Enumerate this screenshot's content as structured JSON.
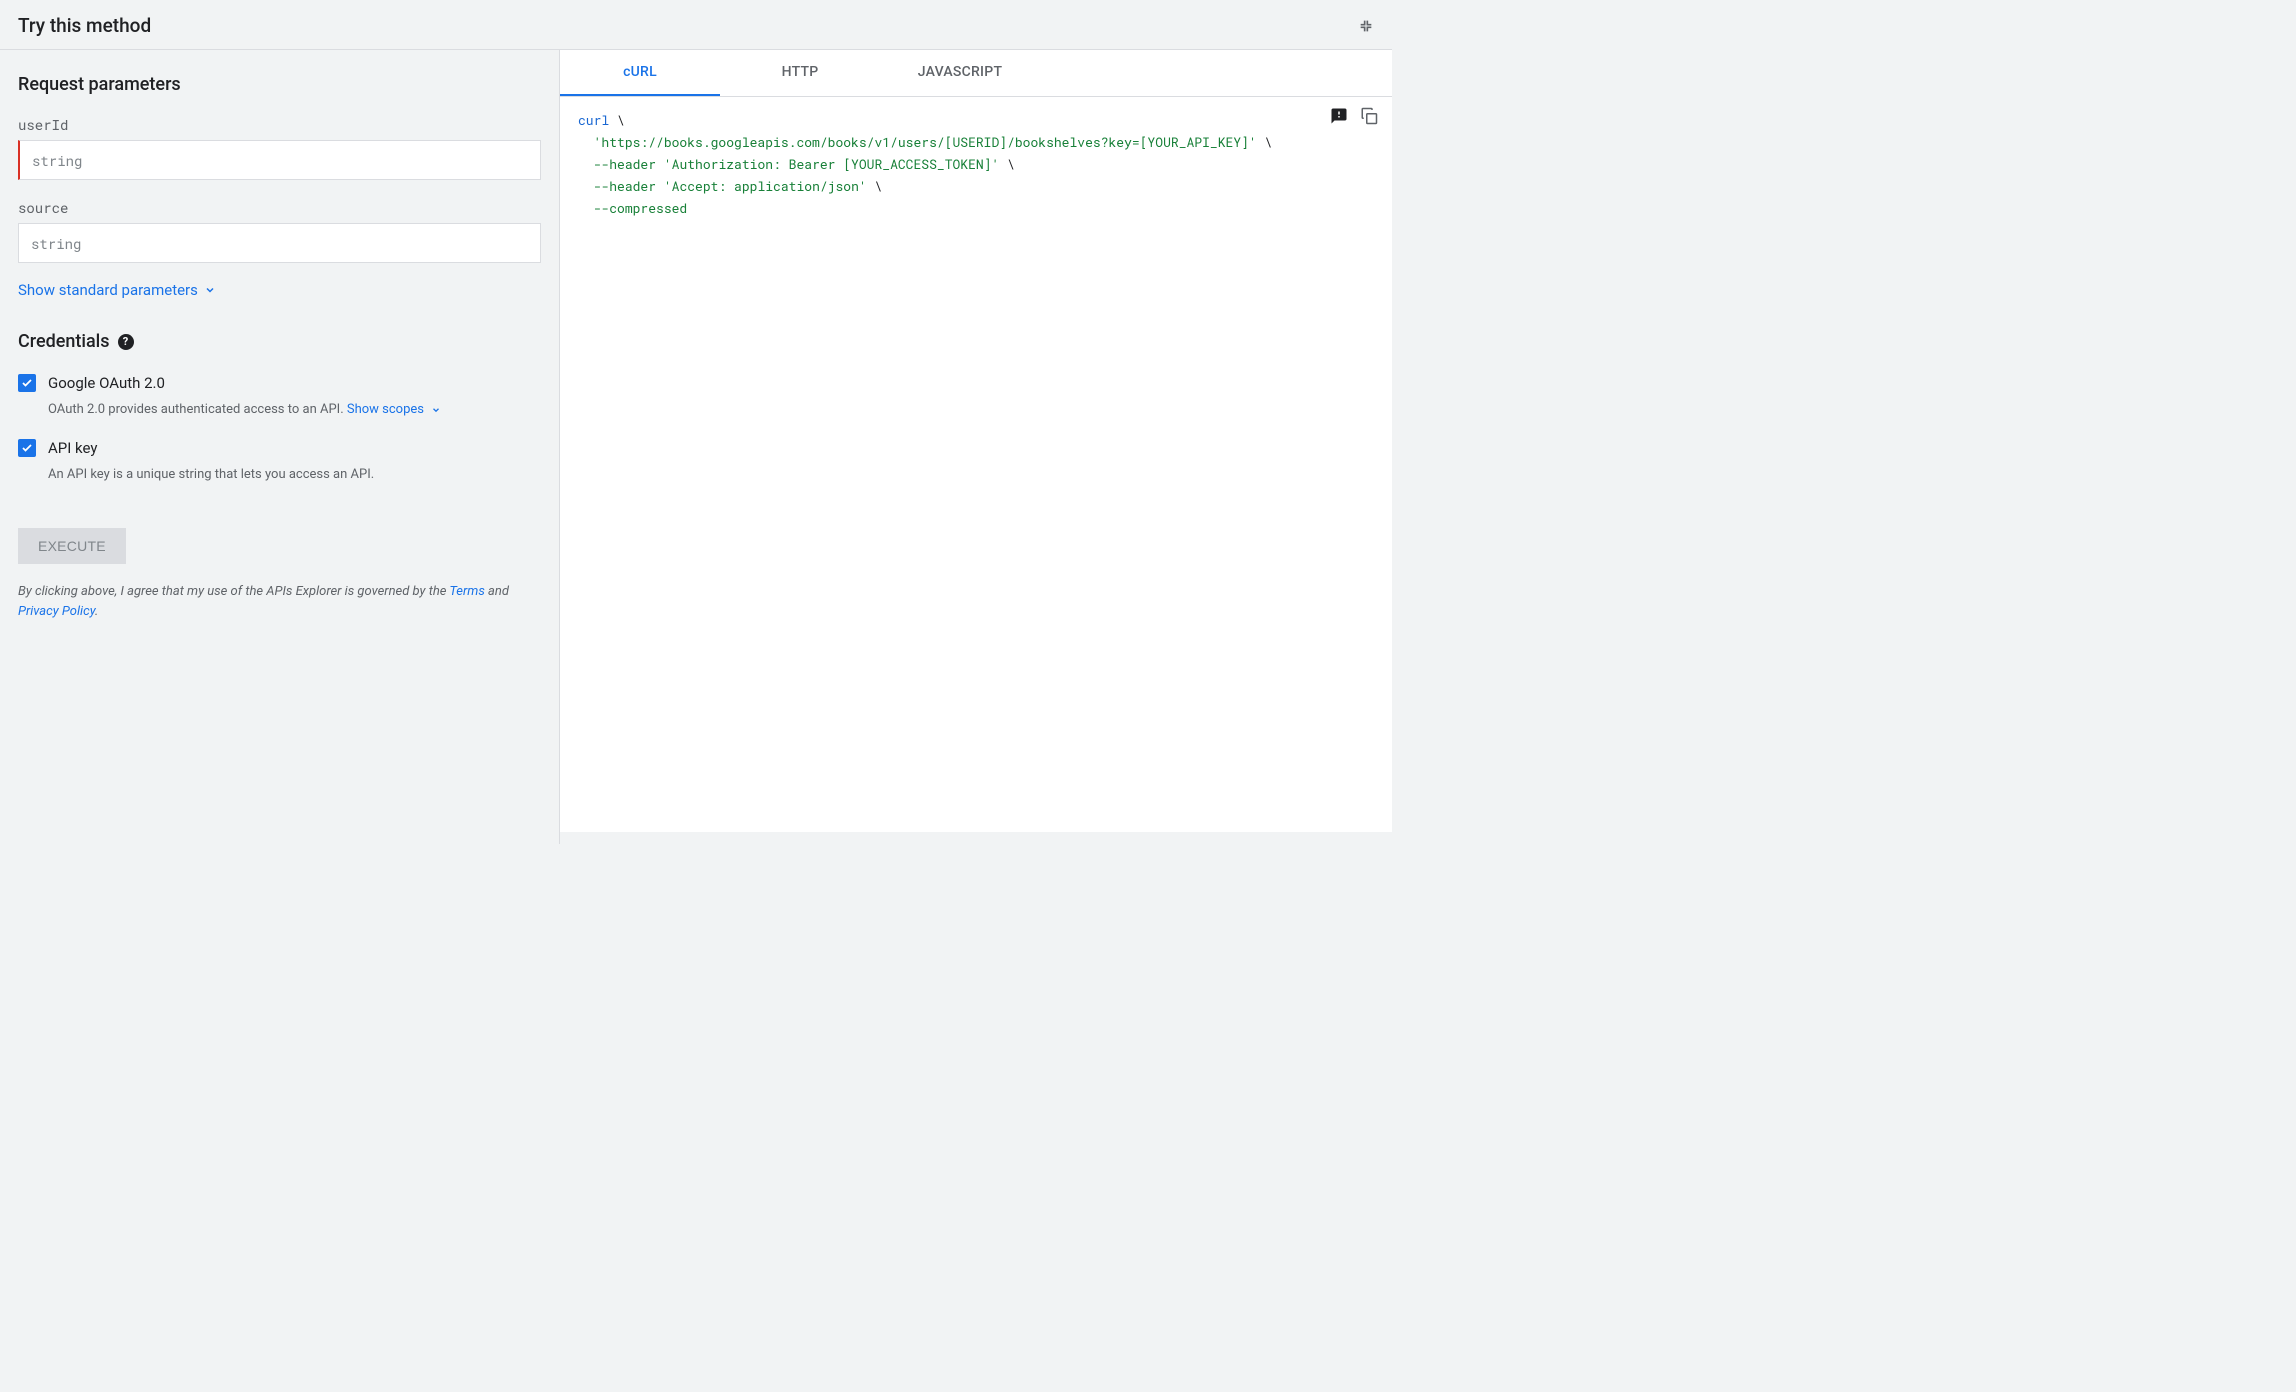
{
  "header": {
    "title": "Try this method"
  },
  "params": {
    "section_title": "Request parameters",
    "items": [
      {
        "name": "userId",
        "placeholder": "string",
        "required": true
      },
      {
        "name": "source",
        "placeholder": "string",
        "required": false
      }
    ],
    "show_standard": "Show standard parameters"
  },
  "credentials": {
    "title": "Credentials",
    "oauth": {
      "label": "Google OAuth 2.0",
      "checked": true,
      "desc_prefix": "OAuth 2.0 provides authenticated access to an API. ",
      "show_scopes": "Show scopes"
    },
    "apikey": {
      "label": "API key",
      "checked": true,
      "desc": "An API key is a unique string that lets you access an API."
    }
  },
  "execute_label": "EXECUTE",
  "disclaimer": {
    "pre": "By clicking above, I agree that my use of the APIs Explorer is governed by the ",
    "terms": "Terms",
    "and": " and ",
    "privacy": "Privacy Policy",
    "post": "."
  },
  "tabs": {
    "curl": "cURL",
    "http": "HTTP",
    "javascript": "JAVASCRIPT",
    "active": "curl"
  },
  "code": {
    "kw_curl": "curl",
    "bs": " \\",
    "line2_url": "'https://books.googleapis.com/books/v1/users/[USERID]/bookshelves?key=[YOUR_API_KEY]'",
    "line3_flag": "--header",
    "line3_val": "'Authorization: Bearer [YOUR_ACCESS_TOKEN]'",
    "line4_flag": "--header",
    "line4_val": "'Accept: application/json'",
    "line5": "--compressed"
  }
}
